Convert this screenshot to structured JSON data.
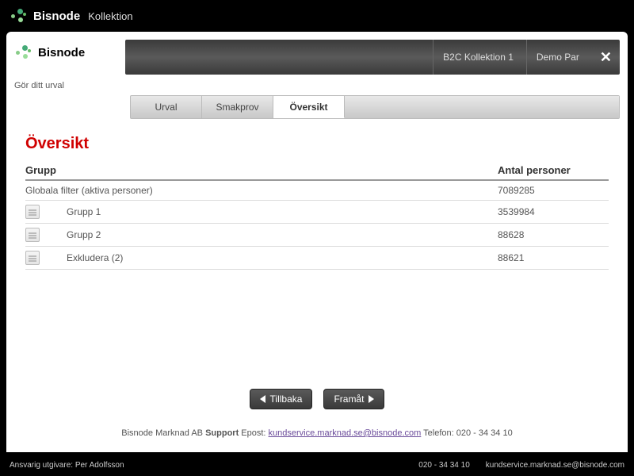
{
  "header": {
    "brand": "Bisnode",
    "product": "Kollektion"
  },
  "panel": {
    "brand": "Bisnode",
    "subtitle": "Gör ditt urval"
  },
  "ribbon": {
    "collection": "B2C Kollektion 1",
    "user": "Demo Par"
  },
  "tabs": [
    {
      "label": "Urval",
      "active": false
    },
    {
      "label": "Smakprov",
      "active": false
    },
    {
      "label": "Översikt",
      "active": true
    }
  ],
  "page": {
    "title": "Översikt",
    "col_group": "Grupp",
    "col_count": "Antal personer",
    "rows": [
      {
        "icon": false,
        "indent": false,
        "label": "Globala filter (aktiva personer)",
        "count": "7089285"
      },
      {
        "icon": true,
        "indent": true,
        "label": "Grupp 1",
        "count": "3539984"
      },
      {
        "icon": true,
        "indent": true,
        "label": "Grupp 2",
        "count": "88628"
      },
      {
        "icon": true,
        "indent": true,
        "label": "Exkludera (2)",
        "count": "88621"
      }
    ]
  },
  "nav": {
    "back": "Tillbaka",
    "forward": "Framåt"
  },
  "support": {
    "prefix": "Bisnode Marknad AB ",
    "bold": "Support",
    "email_label": " Epost: ",
    "email": "kundservice.marknad.se@bisnode.com",
    "phone_label": " Telefon: ",
    "phone": "020 - 34 34 10"
  },
  "footer": {
    "publisher": "Ansvarig utgivare: Per Adolfsson",
    "phone": "020 - 34 34 10",
    "email": "kundservice.marknad.se@bisnode.com"
  }
}
